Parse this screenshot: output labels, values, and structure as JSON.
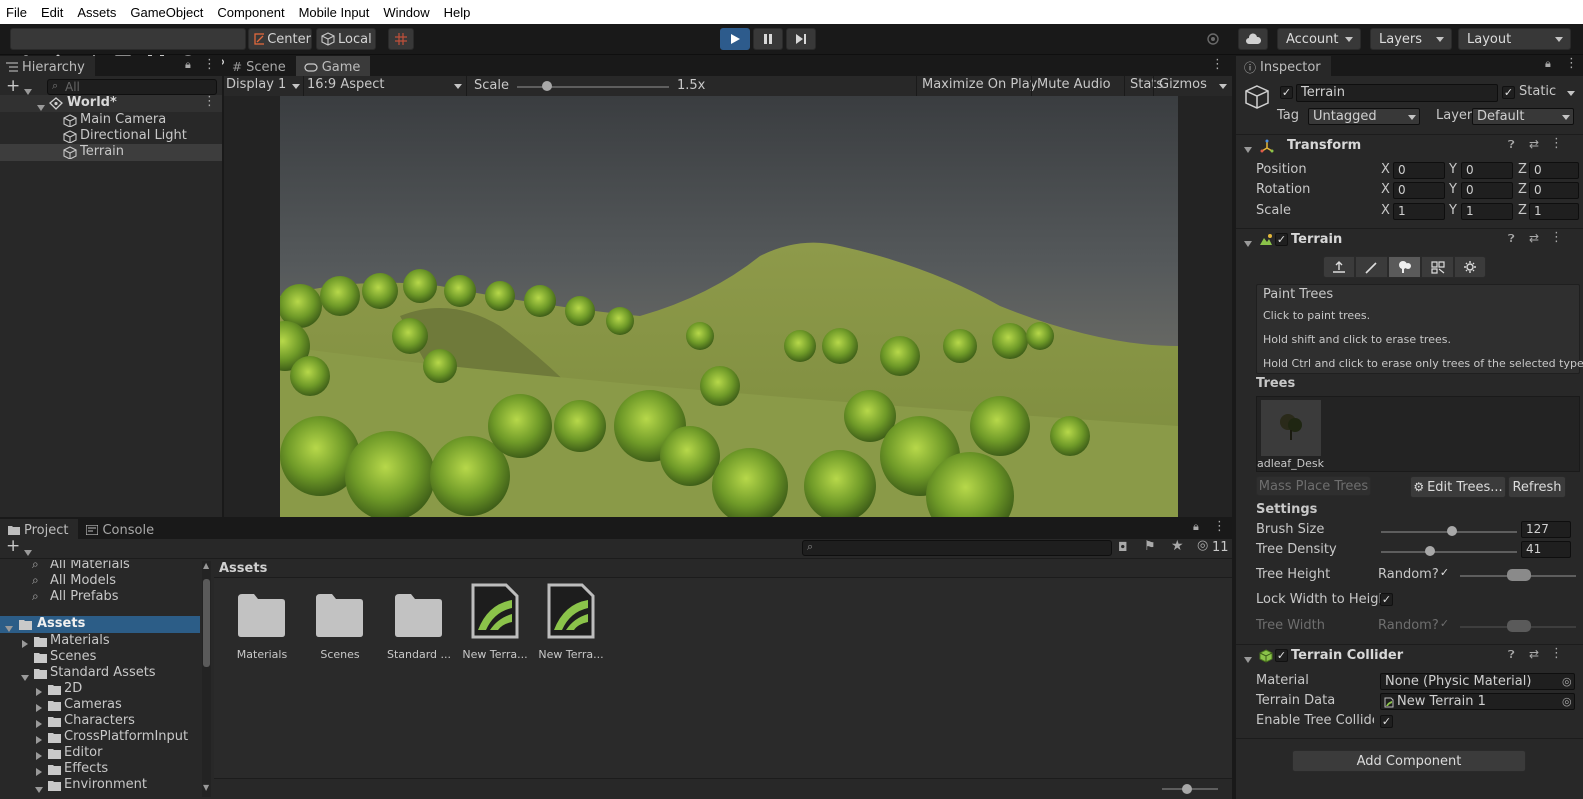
{
  "menu": [
    "File",
    "Edit",
    "Assets",
    "GameObject",
    "Component",
    "Mobile Input",
    "Window",
    "Help"
  ],
  "toolbar": {
    "pivot": "Center",
    "space": "Local",
    "account": "Account",
    "layers": "Layers",
    "layout": "Layout"
  },
  "hierarchy": {
    "tab": "Hierarchy",
    "search_placeholder": "All",
    "scene": "World*",
    "items": [
      "Main Camera",
      "Directional Light",
      "Terrain"
    ]
  },
  "game": {
    "tabs": [
      "Scene",
      "Game"
    ],
    "display": "Display 1",
    "aspect": "16:9 Aspect",
    "scale_label": "Scale",
    "scale_value": "1.5x",
    "scale_level": 0.2,
    "maximize": "Maximize On Play",
    "mute": "Mute Audio",
    "stats": "Stats",
    "gizmos": "Gizmos"
  },
  "project": {
    "tabs": [
      "Project",
      "Console"
    ],
    "badge_count": "11",
    "favorites": [
      "All Materials",
      "All Models",
      "All Prefabs"
    ],
    "tree": {
      "root": "Assets",
      "children": [
        "Materials",
        "Scenes",
        "Standard Assets"
      ],
      "standard_children": [
        "2D",
        "Cameras",
        "Characters",
        "CrossPlatformInput",
        "Editor",
        "Effects",
        "Environment"
      ]
    },
    "breadcrumb": "Assets",
    "assets": [
      {
        "name": "Materials",
        "kind": "folder"
      },
      {
        "name": "Scenes",
        "kind": "folder"
      },
      {
        "name": "Standard ...",
        "kind": "folder"
      },
      {
        "name": "New Terra...",
        "kind": "terrain"
      },
      {
        "name": "New Terra...",
        "kind": "terrain"
      }
    ]
  },
  "inspector": {
    "tab": "Inspector",
    "object_name": "Terrain",
    "static": "Static",
    "tag_label": "Tag",
    "tag": "Untagged",
    "layer_label": "Layer",
    "layer": "Default",
    "transform": {
      "title": "Transform",
      "rows": [
        {
          "label": "Position",
          "x": "0",
          "y": "0",
          "z": "0"
        },
        {
          "label": "Rotation",
          "x": "0",
          "y": "0",
          "z": "0"
        },
        {
          "label": "Scale",
          "x": "1",
          "y": "1",
          "z": "1"
        }
      ]
    },
    "terrain": {
      "title": "Terrain",
      "help_title": "Paint Trees",
      "help_lines": [
        "Click to paint trees.",
        "Hold shift and click to erase trees.",
        "Hold Ctrl and click to erase only trees of the selected type."
      ],
      "trees_label": "Trees",
      "tree_item": "Broadleaf_Desk",
      "tree_item_visible": "adleaf_Desk",
      "mass_place": "Mass Place Trees",
      "edit_trees": "Edit Trees...",
      "refresh": "Refresh",
      "settings_label": "Settings",
      "brush_size_label": "Brush Size",
      "brush_size": "127",
      "brush_level": 0.52,
      "tree_density_label": "Tree Density",
      "tree_density": "41",
      "density_level": 0.36,
      "tree_height_label": "Tree Height",
      "random_label": "Random?",
      "lock_label": "Lock Width to Height",
      "tree_width_label": "Tree Width"
    },
    "collider": {
      "title": "Terrain Collider",
      "material_label": "Material",
      "material": "None (Physic Material)",
      "data_label": "Terrain Data",
      "data": "New Terrain 1",
      "enable_label": "Enable Tree Colliders"
    },
    "add_component": "Add Component"
  },
  "colors": {
    "accent": "#3a72b0",
    "play_active": "#2d5b8c",
    "terrain_green": "#8bc34a"
  }
}
